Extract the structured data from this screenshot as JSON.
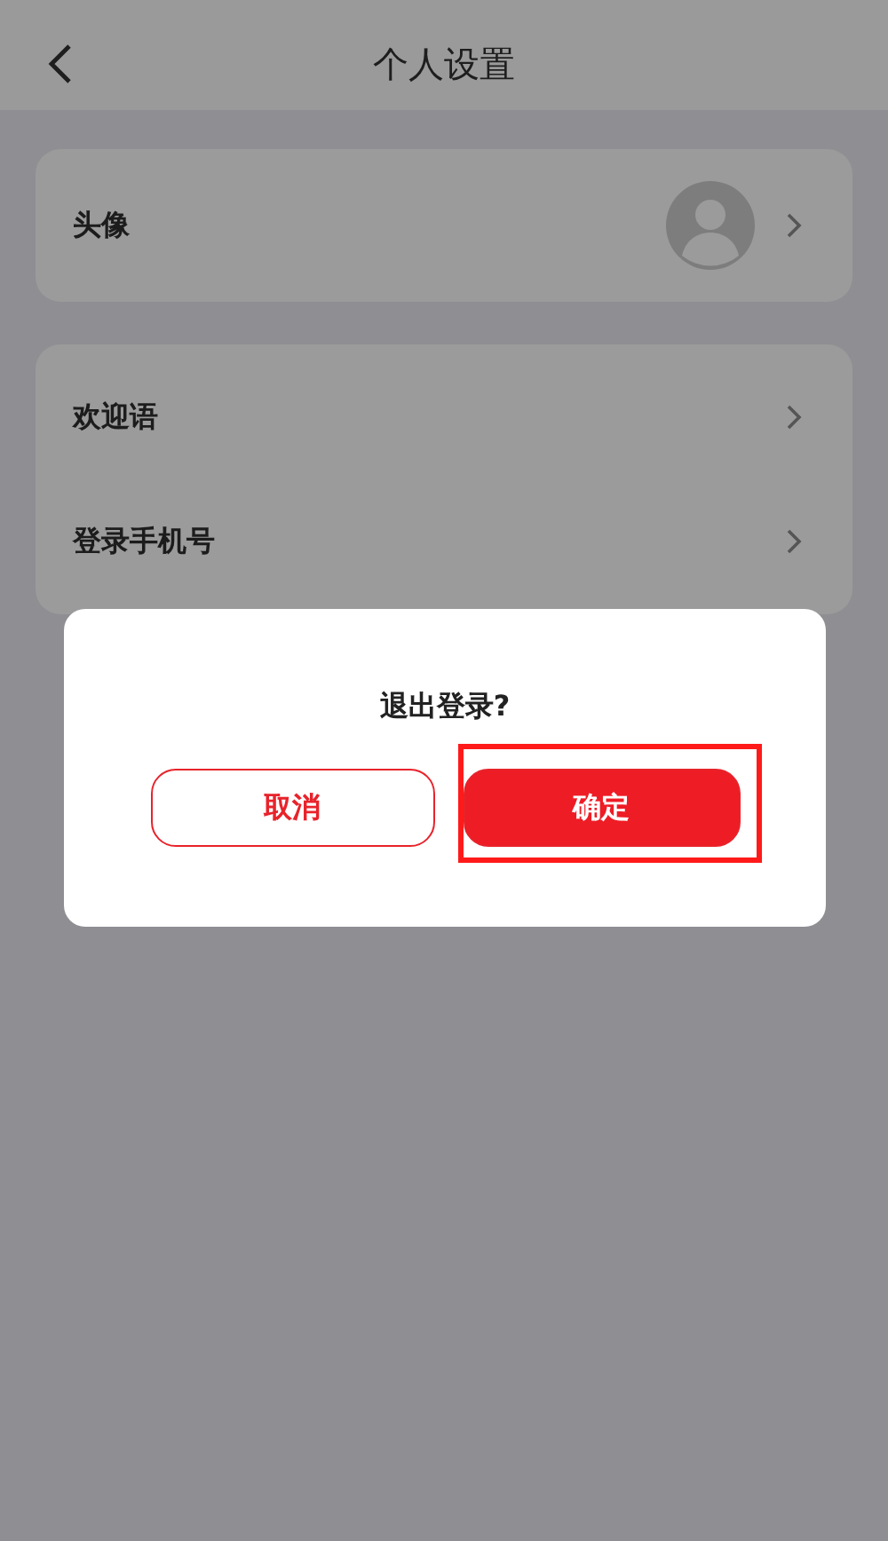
{
  "header": {
    "title": "个人设置"
  },
  "groups": [
    {
      "items": [
        {
          "kind": "avatar",
          "label": "头像"
        }
      ]
    },
    {
      "items": [
        {
          "kind": "plain",
          "label": "欢迎语"
        },
        {
          "kind": "plain",
          "label": "登录手机号"
        }
      ]
    }
  ],
  "dialog": {
    "title": "退出登录?",
    "buttons": [
      {
        "kind": "outline",
        "label": "取消",
        "highlighted": false
      },
      {
        "kind": "filled",
        "label": "确定",
        "highlighted": true
      }
    ]
  }
}
